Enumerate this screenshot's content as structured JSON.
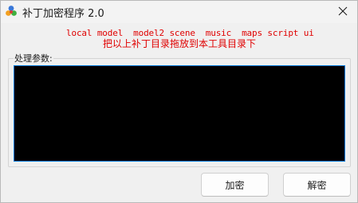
{
  "window": {
    "title": "补丁加密程序 2.0",
    "app_icon": "colored-dots-app-icon",
    "close_icon": "close-icon"
  },
  "hints": {
    "line1": "local model  model2 scene  music  maps script ui",
    "line2": "把以上补丁目录拖放到本工具目录下",
    "color": "#e00000"
  },
  "params": {
    "label": "处理参数:",
    "value": "",
    "background": "#000000",
    "border": "#0078d7"
  },
  "buttons": {
    "encrypt": "加密",
    "decrypt": "解密"
  }
}
